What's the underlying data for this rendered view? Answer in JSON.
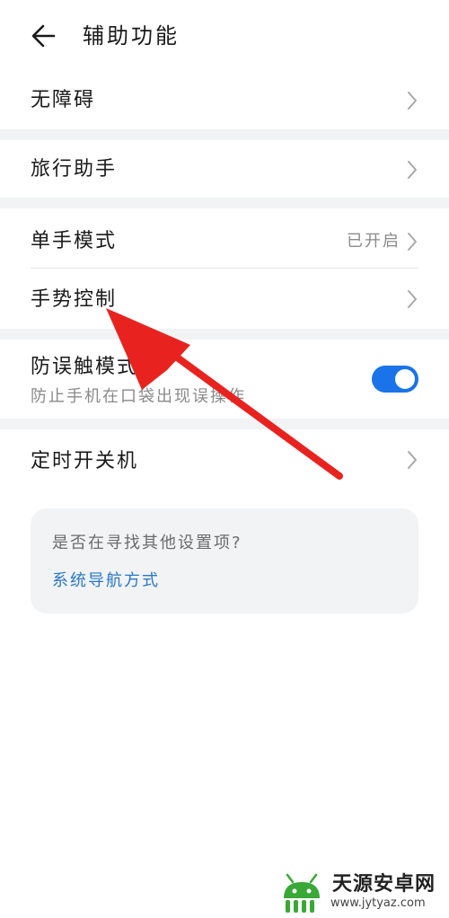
{
  "header": {
    "title": "辅助功能",
    "back_icon": "arrow-left-icon"
  },
  "items": [
    {
      "label": "无障碍",
      "chevron_icon": "chevron-right-icon"
    },
    {
      "label": "旅行助手",
      "chevron_icon": "chevron-right-icon"
    },
    {
      "label": "单手模式",
      "value": "已开启",
      "chevron_icon": "chevron-right-icon"
    },
    {
      "label": "手势控制",
      "chevron_icon": "chevron-right-icon"
    },
    {
      "label": "防误触模式",
      "subtitle": "防止手机在口袋出现误操作",
      "toggle_on": true
    },
    {
      "label": "定时开关机",
      "chevron_icon": "chevron-right-icon"
    }
  ],
  "suggestion": {
    "question": "是否在寻找其他设置项?",
    "link": "系统导航方式"
  },
  "watermark": {
    "name": "天源安卓网",
    "url": "www.jytyaz.com"
  },
  "colors": {
    "accent": "#1a73e8",
    "link": "#2a78c8",
    "annotation_arrow": "#e8231f",
    "watermark_green": "#3aa836"
  }
}
